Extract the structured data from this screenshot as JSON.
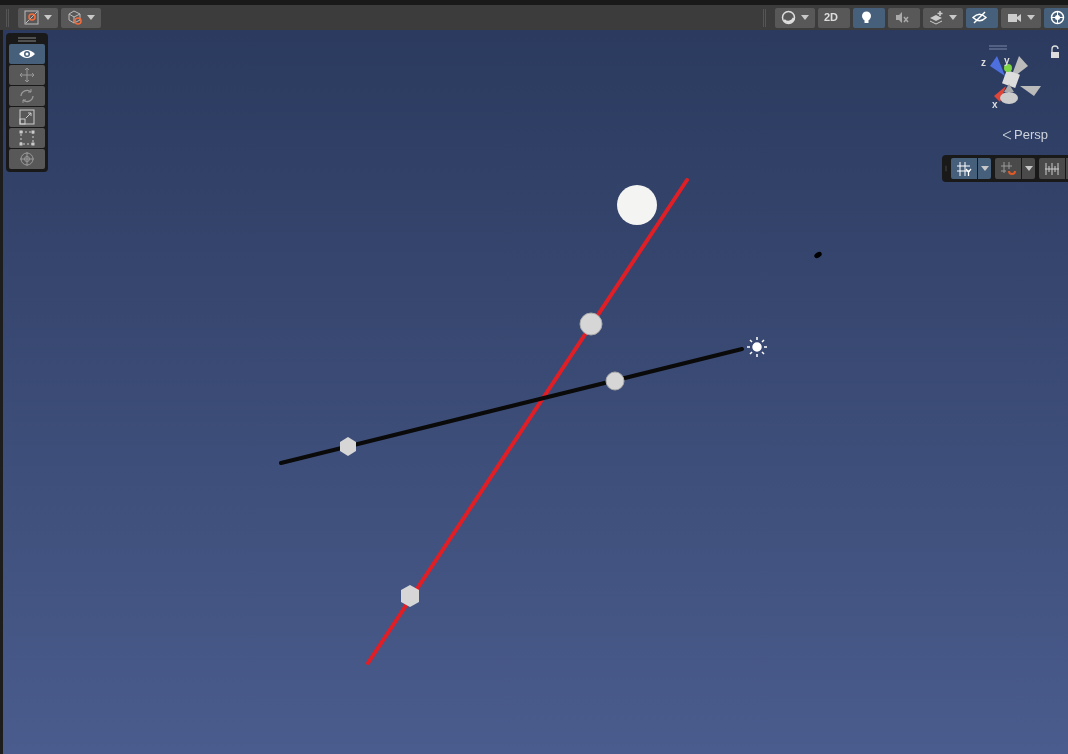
{
  "toolbar_left": [
    {
      "dropdown": true,
      "selected": false
    },
    {
      "dropdown": true,
      "selected": false
    }
  ],
  "toolbar_right": [
    {
      "kind": "icon",
      "dropdown": true,
      "selected": false
    },
    {
      "kind": "text",
      "label": "2D",
      "selected": false
    },
    {
      "kind": "icon",
      "dropdown": false,
      "selected": true
    },
    {
      "kind": "icon",
      "dropdown": false,
      "selected": false
    },
    {
      "kind": "icon",
      "dropdown": true,
      "selected": false
    },
    {
      "kind": "icon",
      "dropdown": false,
      "selected": true
    },
    {
      "kind": "icon",
      "dropdown": true,
      "selected": false
    },
    {
      "kind": "icon",
      "dropdown": false,
      "selected": true
    }
  ],
  "tools": [
    {
      "selected": true
    },
    {
      "selected": false
    },
    {
      "selected": false
    },
    {
      "selected": false
    },
    {
      "selected": false
    },
    {
      "selected": false
    }
  ],
  "gizmo": {
    "x_label": "x",
    "y_label": "y",
    "z_label": "z",
    "projection": "Persp"
  },
  "grid_toolbar": [
    {
      "selected": true
    },
    {
      "selected": false
    },
    {
      "selected": false
    }
  ]
}
